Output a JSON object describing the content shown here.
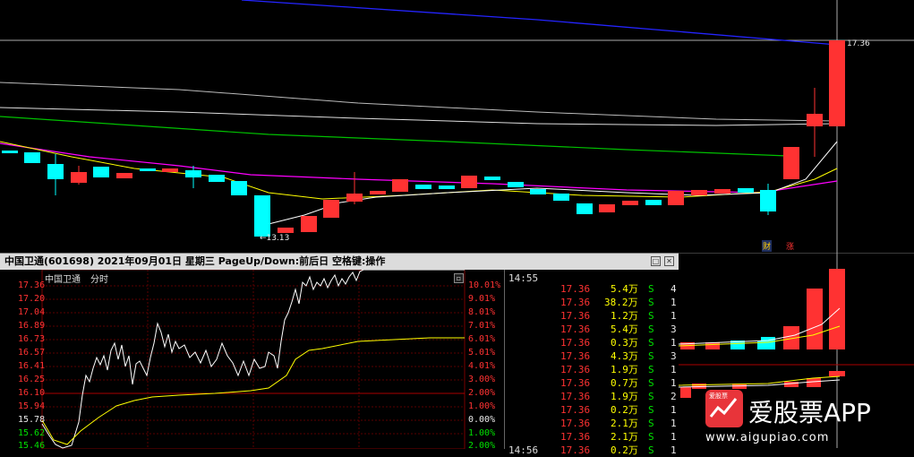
{
  "kline": {
    "price_tag": "17.36",
    "low_tag": "←13.13",
    "badge_cai": "财",
    "badge_zhang": "涨"
  },
  "popup": {
    "title": "中国卫通(601698)  2021年09月01日 星期三  PageUp/Down:前后日  空格键:操作",
    "chart_name": "中国卫通",
    "chart_mode": "分时",
    "close_glyph": "✕",
    "max_glyph": "□"
  },
  "minute_chart": {
    "price_labels": [
      "17.36",
      "17.20",
      "17.04",
      "16.89",
      "16.73",
      "16.57",
      "16.41",
      "16.25",
      "16.10",
      "15.94",
      "15.78",
      "15.62",
      "15.46"
    ],
    "pct_labels": [
      "10.01%",
      "9.01%",
      "8.01%",
      "7.01%",
      "6.01%",
      "5.01%",
      "4.01%",
      "3.00%",
      "2.00%",
      "1.00%",
      "0.00%",
      "1.00%",
      "2.00%"
    ]
  },
  "ticks": {
    "time_top": "14:55",
    "time_bottom": "14:56",
    "rows": [
      {
        "price": "17.36",
        "vol": "5.4万",
        "side": "S",
        "n": "4"
      },
      {
        "price": "17.36",
        "vol": "38.2万",
        "side": "S",
        "n": "1"
      },
      {
        "price": "17.36",
        "vol": "1.2万",
        "side": "S",
        "n": "1"
      },
      {
        "price": "17.36",
        "vol": "5.4万",
        "side": "S",
        "n": "3"
      },
      {
        "price": "17.36",
        "vol": "0.3万",
        "side": "S",
        "n": "1"
      },
      {
        "price": "17.36",
        "vol": "4.3万",
        "side": "S",
        "n": "3"
      },
      {
        "price": "17.36",
        "vol": "1.9万",
        "side": "S",
        "n": "1"
      },
      {
        "price": "17.36",
        "vol": "0.7万",
        "side": "S",
        "n": "1"
      },
      {
        "price": "17.36",
        "vol": "1.9万",
        "side": "S",
        "n": "2"
      },
      {
        "price": "17.36",
        "vol": "0.2万",
        "side": "S",
        "n": "1"
      },
      {
        "price": "17.36",
        "vol": "2.1万",
        "side": "S",
        "n": "1"
      },
      {
        "price": "17.36",
        "vol": "2.1万",
        "side": "S",
        "n": "1"
      },
      {
        "price": "17.36",
        "vol": "0.2万",
        "side": "S",
        "n": "1"
      }
    ]
  },
  "watermark": {
    "brand": "爱股票APP",
    "url": "www.aigupiao.com",
    "box_label": "爱股票"
  },
  "colors": {
    "up": "#ff3232",
    "down": "#00ffff",
    "ma_white": "#e0e0e0",
    "ma_yellow": "#ffff00",
    "ma_magenta": "#ff00ff",
    "ma_green": "#00c000",
    "ma_blue": "#0000ff"
  }
}
